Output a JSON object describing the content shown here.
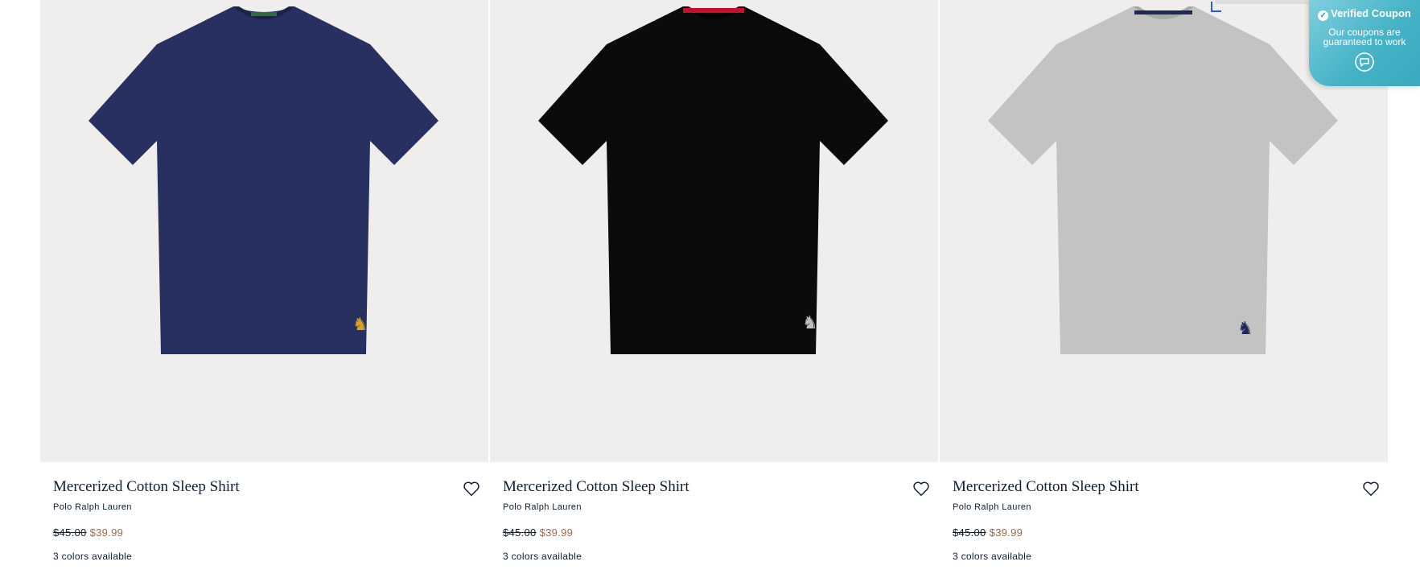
{
  "products": [
    {
      "title": "Mercerized Cotton Sleep Shirt",
      "brand": "Polo Ralph Lauren",
      "price_was": "$45.00",
      "price_now": "$39.99",
      "colors_text": "3 colors available",
      "shirt_color": "#27305f",
      "collar_color": "#1c2346",
      "tape_color": "#2f6b3c",
      "pony_color": "#d9a41b"
    },
    {
      "title": "Mercerized Cotton Sleep Shirt",
      "brand": "Polo Ralph Lauren",
      "price_was": "$45.00",
      "price_now": "$39.99",
      "colors_text": "3 colors available",
      "shirt_color": "#0b0b0b",
      "collar_color": "#050505",
      "tape_color": "#c8102e",
      "pony_color": "#bfbfbf"
    },
    {
      "title": "Mercerized Cotton Sleep Shirt",
      "brand": "Polo Ralph Lauren",
      "price_was": "$45.00",
      "price_now": "$39.99",
      "colors_text": "3 colors available",
      "shirt_color": "#c3c3c3",
      "collar_color": "#a9a9a9",
      "tape_color": "#1e2a55",
      "pony_color": "#1e2a55"
    }
  ],
  "coupon": {
    "title": "Verified Coupon",
    "line1": "Our coupons are",
    "line2": "guaranteed to work"
  },
  "colors": {
    "price_sale": "#a0684a",
    "text": "#0f1e36",
    "image_bg": "#efeeed"
  }
}
